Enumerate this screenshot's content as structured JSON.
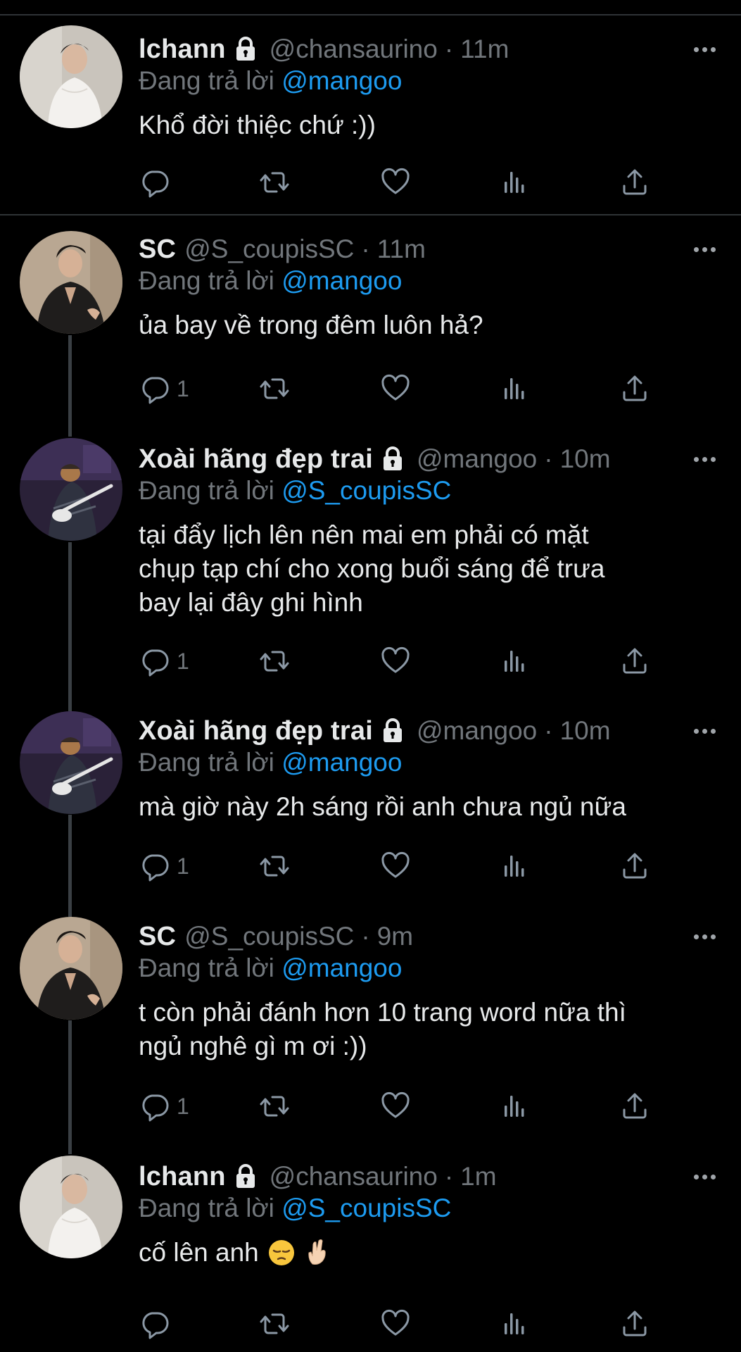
{
  "replying_prefix": "Đang trả lời",
  "tweets": [
    {
      "name": "lchann",
      "handle": "@chansaurino",
      "dot": "·",
      "time": "11m",
      "reply_to": "@mangoo",
      "text": "Khổ đời thiệc chứ :))",
      "reply_count": "",
      "locked": true,
      "avatar": "white-shirt-avatar"
    },
    {
      "name": "SC",
      "handle": "@S_coupisSC",
      "dot": "·",
      "time": "11m",
      "reply_to": "@mangoo",
      "text": "ủa bay về trong đêm luôn hả?",
      "reply_count": "1",
      "locked": false,
      "avatar": "black-suit-avatar"
    },
    {
      "name": "Xoài hãng đẹp trai",
      "handle": "@mangoo",
      "dot": "·",
      "time": "10m",
      "reply_to": "@S_coupisSC",
      "text": "tại đẩy lịch lên nên mai em phải có mặt\nchụp tạp chí cho xong buổi sáng để trưa\nbay lại đây ghi hình",
      "reply_count": "1",
      "locked": true,
      "avatar": "dog-guitar-avatar"
    },
    {
      "name": "Xoài hãng đẹp trai",
      "handle": "@mangoo",
      "dot": "·",
      "time": "10m",
      "reply_to": "@mangoo",
      "text": "mà giờ này 2h sáng rồi anh chưa ngủ nữa",
      "reply_count": "1",
      "locked": true,
      "avatar": "dog-guitar-avatar"
    },
    {
      "name": "SC",
      "handle": "@S_coupisSC",
      "dot": "·",
      "time": "9m",
      "reply_to": "@mangoo",
      "text": "t còn phải đánh hơn 10 trang word nữa thì\nngủ nghê gì m ơi :))",
      "reply_count": "1",
      "locked": false,
      "avatar": "black-suit-avatar"
    },
    {
      "name": "lchann",
      "handle": "@chansaurino",
      "dot": "·",
      "time": "1m",
      "reply_to": "@S_coupisSC",
      "text": "cố lên anh",
      "reply_count": "",
      "locked": true,
      "avatar": "white-shirt-avatar",
      "emojis": [
        "pensive-face-emoji",
        "crossed-fingers-emoji"
      ]
    }
  ],
  "colors": {
    "background": "#000000",
    "text": "#e7e9ea",
    "muted": "#71767b",
    "mention": "#1d9bf0",
    "divider": "#2f3336"
  },
  "icons": {
    "lock": "lock-icon",
    "more": "more-icon",
    "reply": "reply-icon",
    "retweet": "retweet-icon",
    "like": "heart-icon",
    "views": "views-icon",
    "share": "share-icon"
  }
}
